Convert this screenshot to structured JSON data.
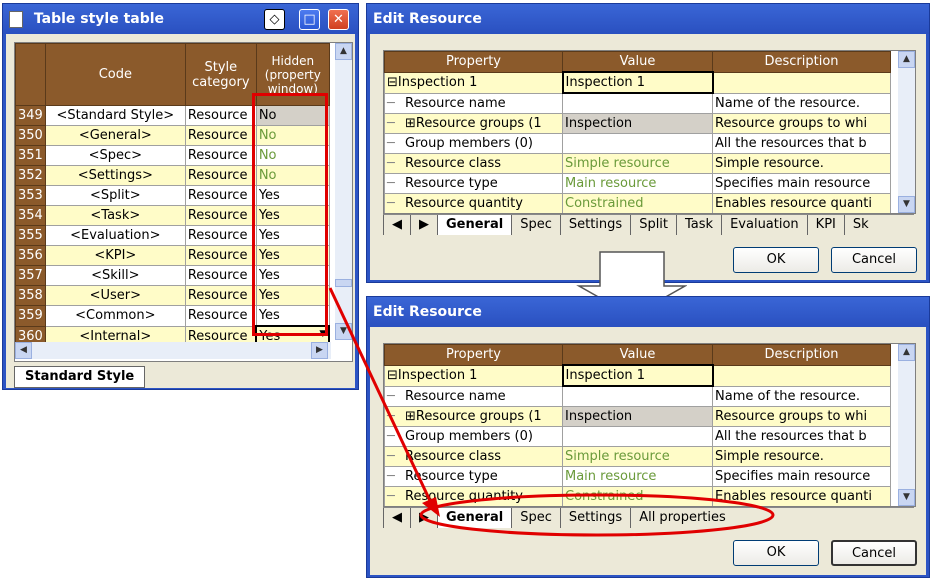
{
  "left": {
    "title": "Table style table",
    "headers": [
      "Code",
      "Style category",
      "Hidden (property window)"
    ],
    "rows": [
      {
        "num": "349",
        "code": "<Standard Style>",
        "cat": "Resource",
        "hidden": "No"
      },
      {
        "num": "350",
        "code": "<General>",
        "cat": "Resource",
        "hidden": "No"
      },
      {
        "num": "351",
        "code": "<Spec>",
        "cat": "Resource",
        "hidden": "No"
      },
      {
        "num": "352",
        "code": "<Settings>",
        "cat": "Resource",
        "hidden": "No"
      },
      {
        "num": "353",
        "code": "<Split>",
        "cat": "Resource",
        "hidden": "Yes"
      },
      {
        "num": "354",
        "code": "<Task>",
        "cat": "Resource",
        "hidden": "Yes"
      },
      {
        "num": "355",
        "code": "<Evaluation>",
        "cat": "Resource",
        "hidden": "Yes"
      },
      {
        "num": "356",
        "code": "<KPI>",
        "cat": "Resource",
        "hidden": "Yes"
      },
      {
        "num": "357",
        "code": "<Skill>",
        "cat": "Resource",
        "hidden": "Yes"
      },
      {
        "num": "358",
        "code": "<User>",
        "cat": "Resource",
        "hidden": "Yes"
      },
      {
        "num": "359",
        "code": "<Common>",
        "cat": "Resource",
        "hidden": "Yes"
      },
      {
        "num": "360",
        "code": "<Internal>",
        "cat": "Resource",
        "hidden": "Yes"
      }
    ],
    "sheet_tab": "Standard Style"
  },
  "dialog": {
    "title": "Edit Resource",
    "headers": [
      "Property",
      "Value",
      "Description"
    ],
    "root": {
      "prop": "Inspection 1",
      "value": "Inspection 1"
    },
    "rows": [
      {
        "prop": "Resource name",
        "value": "",
        "desc": "Name of the resource."
      },
      {
        "prop": "Resource groups (1",
        "value": "Inspection",
        "desc": "Resource groups to whi"
      },
      {
        "prop": "Group members (0)",
        "value": "",
        "desc": "All the resources that b"
      },
      {
        "prop": "Resource class",
        "value": "Simple resource",
        "desc": "Simple resource."
      },
      {
        "prop": "Resource type",
        "value": "Main resource",
        "desc": "Specifies main resource"
      },
      {
        "prop": "Resource quantity",
        "value": "Constrained",
        "desc": "Enables resource quanti"
      }
    ],
    "tabs_top": [
      "General",
      "Spec",
      "Settings",
      "Split",
      "Task",
      "Evaluation",
      "KPI",
      "Sk"
    ],
    "tabs_bottom": [
      "General",
      "Spec",
      "Settings",
      "All properties"
    ],
    "ok": "OK",
    "cancel": "Cancel"
  },
  "colors": {
    "header": "#8b5a2b",
    "highlight": "#ff0000",
    "title": "#2c54c4"
  }
}
